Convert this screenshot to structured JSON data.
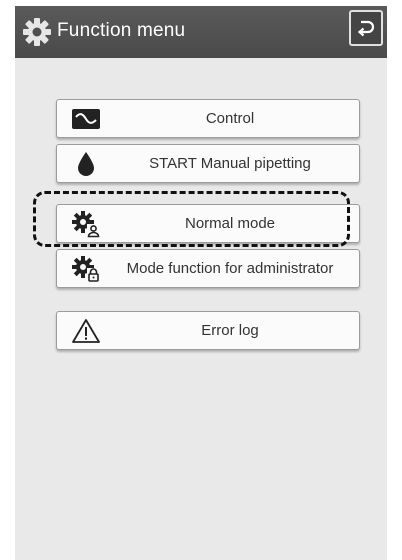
{
  "header": {
    "title": "Function menu",
    "gear_icon": "gear-icon",
    "back_icon": "return-arrow-icon"
  },
  "menu": {
    "items": [
      {
        "label": "Control",
        "icon": "chart-icon"
      },
      {
        "label": "START Manual pipetting",
        "icon": "droplet-icon"
      },
      {
        "label": "Normal mode",
        "icon": "gear-user-icon",
        "highlighted": true
      },
      {
        "label": "Mode function for administrator",
        "icon": "gear-lock-icon"
      },
      {
        "label": "Error log",
        "icon": "warning-icon"
      }
    ]
  },
  "colors": {
    "header_bg": "#4a4a4a",
    "panel_bg": "#e9e9e9",
    "button_bg": "#fbfbfb",
    "icon_dark": "#222222"
  }
}
